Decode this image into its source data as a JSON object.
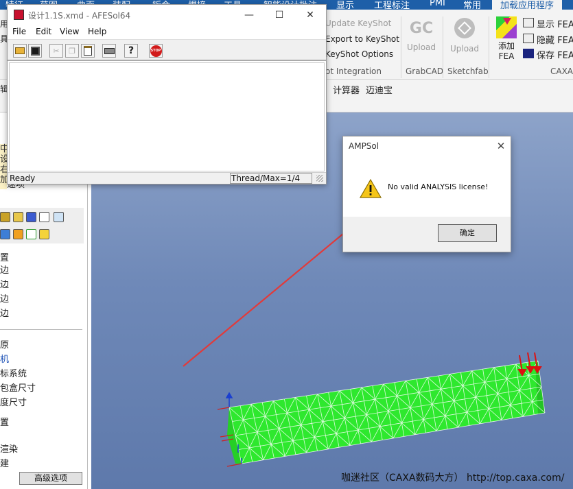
{
  "ribbon": {
    "tabs": [
      {
        "label": "特征"
      },
      {
        "label": "草图"
      },
      {
        "label": "曲面"
      },
      {
        "label": "装配"
      },
      {
        "label": "钣金"
      },
      {
        "label": "焊接"
      },
      {
        "label": "工具"
      },
      {
        "label": "智能设计批注"
      },
      {
        "label": "显示"
      },
      {
        "label": "工程标注"
      },
      {
        "label": "PMI"
      },
      {
        "label": "常用"
      },
      {
        "label": "加载应用程序"
      }
    ],
    "keyshot": {
      "update": "Update KeyShot",
      "export": "Export to KeyShot",
      "options": "KeyShot Options",
      "group": "ot Integration"
    },
    "grabcad": {
      "logo": "GC",
      "label": "Upload",
      "group": "GrabCAD"
    },
    "sketchfab": {
      "label": "Upload",
      "group": "Sketchfab"
    },
    "fea": {
      "add_line1": "添加",
      "add_line2": "FEA",
      "show": "显示 FEA",
      "hide": "隐藏 FEA",
      "save": "保存 FEA",
      "group": "CAXA"
    },
    "left_stubs": {
      "row1": "用",
      "row2": "具",
      "row3": "辑"
    },
    "toolbar2": {
      "calc": "计算器",
      "maidibao": "迈迪宝"
    }
  },
  "left_panel": {
    "yellow_chars": [
      "中",
      "设",
      "右",
      "加"
    ],
    "yellow_tail": "速项",
    "items_a": [
      "置",
      "边",
      "边",
      "边",
      "边"
    ],
    "items_b": [
      "原",
      "机",
      "标系统",
      "包盒尺寸",
      "度尺寸",
      "置",
      "渲染",
      "建"
    ],
    "advanced_button": "高级选项"
  },
  "afesol": {
    "title": "设计1.1S.xmd - AFESol64",
    "menu": [
      "File",
      "Edit",
      "View",
      "Help"
    ],
    "status": "Ready",
    "thread": "Thread/Max=1/4",
    "stop_label": "STOP",
    "help_label": "?"
  },
  "ampsol": {
    "title": "AMPSol",
    "message": "No valid ANALYSIS license!",
    "ok": "确定"
  },
  "watermark": "咖迷社区（CAXA数码大方） http://top.caxa.com/",
  "colors": {
    "ribbon_blue": "#1e5fa8",
    "mesh_green": "#2ee82e",
    "arrow_red": "#e23a3a"
  }
}
